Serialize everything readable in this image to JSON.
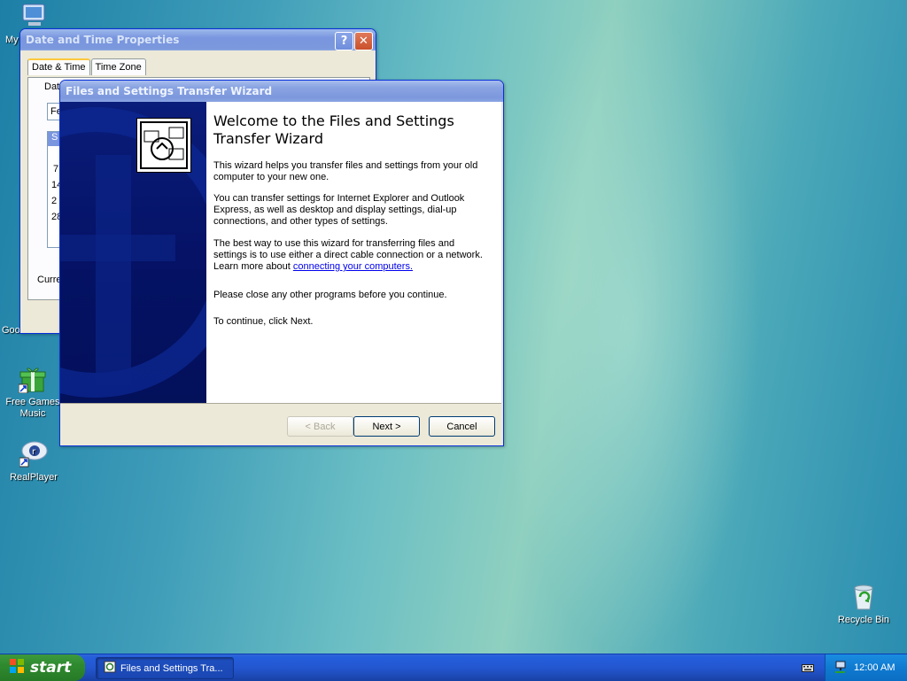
{
  "desktop": {
    "icons": [
      {
        "label": "Free Games Music",
        "icon": "gift-icon"
      },
      {
        "label": "RealPlayer",
        "icon": "realplayer-icon"
      },
      {
        "label": "Recycle Bin",
        "icon": "recycle-bin-icon"
      }
    ],
    "partial_labels": {
      "my": "My",
      "goo": "Goo"
    }
  },
  "datetime_window": {
    "title": "Date and Time Properties",
    "tabs": [
      "Date & Time",
      "Time Zone"
    ],
    "partial": {
      "group": "Dat",
      "month": "Fe",
      "day_header": "S",
      "row1": "7",
      "row2": "14",
      "row3": "2",
      "row4": "28",
      "current": "Curre"
    }
  },
  "wizard": {
    "title": "Files and Settings Transfer Wizard",
    "heading": "Welcome to the Files and Settings Transfer Wizard",
    "p1": "This wizard helps you transfer files and settings from your old computer to your new one.",
    "p2": "You can transfer settings for Internet Explorer and Outlook Express, as well as desktop and display settings, dial-up connections, and other types of settings.",
    "p3_before": "The best way to use this wizard for transferring files and settings is to use either a direct cable connection or a network. Learn more about ",
    "p3_link": "connecting your computers.",
    "p4": "Please close any other programs before you continue.",
    "p5": "To continue, click Next.",
    "buttons": {
      "back": "< Back",
      "next": "Next >",
      "cancel": "Cancel"
    }
  },
  "taskbar": {
    "start_label": "start",
    "task_label": "Files and Settings Tra...",
    "clock": "12:00 AM"
  },
  "colors": {
    "title_active": "#7c97dc",
    "wizard_panel": "#051266",
    "taskbar": "#245edb",
    "start_green": "#2f8a2f"
  }
}
